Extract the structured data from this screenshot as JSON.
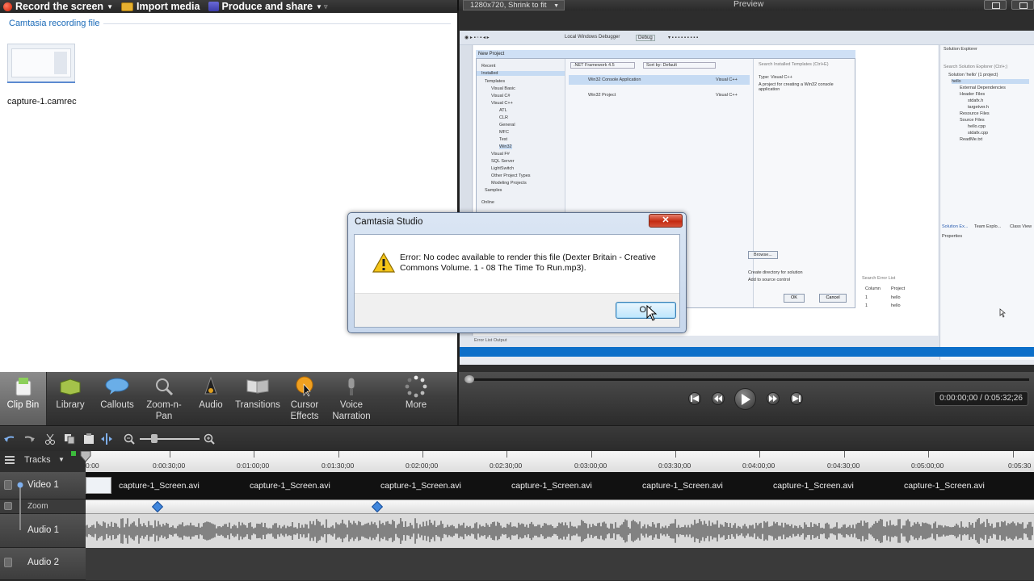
{
  "toolbar": {
    "record_label": "Record the screen",
    "import_label": "Import media",
    "produce_label": "Produce and share"
  },
  "clip_bin": {
    "heading": "Camtasia recording file",
    "clip_name": "capture-1.camrec"
  },
  "tools": [
    {
      "label": "Clip Bin"
    },
    {
      "label": "Library"
    },
    {
      "label": "Callouts"
    },
    {
      "label": "Zoom-n-Pan"
    },
    {
      "label": "Audio"
    },
    {
      "label": "Transitions"
    },
    {
      "label": "Cursor Effects"
    },
    {
      "label": "Voice Narration"
    },
    {
      "label": "More"
    }
  ],
  "preview": {
    "dimensions_select": "1280x720, Shrink to fit",
    "title": "Preview",
    "time_display": "0:00:00;00 / 0:05:32;26"
  },
  "vs_screenshot": {
    "toolbar_debugger": "Local Windows Debugger",
    "toolbar_config": "Debug",
    "dialog_title": "New Project",
    "framework": ".NET Framework 4.5",
    "sort_by": "Sort by: Default",
    "search_placeholder": "Search Installed Templates (Ctrl+E)",
    "tree": [
      "Recent",
      "Installed",
      "Templates",
      "Visual Basic",
      "Visual C#",
      "Visual C++",
      "ATL",
      "CLR",
      "General",
      "MFC",
      "Test",
      "Win32",
      "Visual F#",
      "SQL Server",
      "LightSwitch",
      "Other Project Types",
      "Modeling Projects",
      "Samples",
      "Online"
    ],
    "templates": [
      {
        "name": "Win32 Console Application",
        "lang": "Visual C++"
      },
      {
        "name": "Win32 Project",
        "lang": "Visual C++"
      }
    ],
    "type_label": "Type: Visual C++",
    "type_desc": "A project for creating a Win32 console application",
    "browse_label": "Browse...",
    "create_dir_label": "Create directory for solution",
    "add_source_label": "Add to source control",
    "ok_label": "OK",
    "cancel_label": "Cancel",
    "se_title": "Solution Explorer",
    "se_search": "Search Solution Explorer (Ctrl+;)",
    "se_items": [
      "Solution 'hello' (1 project)",
      "hello",
      "External Dependencies",
      "Header Files",
      "stdafx.h",
      "targetver.h",
      "Resource Files",
      "Source Files",
      "hello.cpp",
      "stdafx.cpp",
      "ReadMe.txt"
    ],
    "se_tabs": [
      "Solution Ex...",
      "Team Explo...",
      "Class View"
    ],
    "properties_title": "Properties",
    "error_list_search": "Search Error List",
    "error_cols": [
      "Column",
      "Project"
    ],
    "error_rows": [
      {
        "num": "1",
        "project": "hello"
      },
      {
        "num": "1",
        "project": "hello"
      }
    ],
    "status_tabs": "Error List   Output"
  },
  "dialog": {
    "title": "Camtasia Studio",
    "message": "Error: No codec available to render this file (Dexter Britain - Creative Commons Volume. 1 - 08 The Time To Run.mp3).",
    "ok_label": "OK"
  },
  "timeline": {
    "tracks_label": "Tracks",
    "ticks": [
      "0:00",
      "0:00:30;00",
      "0:01:00;00",
      "0:01:30;00",
      "0:02:00;00",
      "0:02:30;00",
      "0:03:00;00",
      "0:03:30;00",
      "0:04:00;00",
      "0:04:30;00",
      "0:05:00;00",
      "0:05:30"
    ],
    "video_track_label": "Video 1",
    "zoom_track_label": "Zoom",
    "audio1_label": "Audio 1",
    "audio2_label": "Audio 2",
    "video_clips": [
      "capture-1_Screen.avi",
      "capture-1_Screen.avi",
      "capture-1_Screen.avi",
      "capture-1_Screen.avi",
      "capture-1_Screen.avi",
      "capture-1_Screen.avi",
      "capture-1_Screen.avi"
    ]
  },
  "colors": {
    "accent_blue": "#0c6fc9",
    "heading_blue": "#1a6ab8",
    "record_red": "#d01a00",
    "dialog_close_red": "#c42b12"
  }
}
